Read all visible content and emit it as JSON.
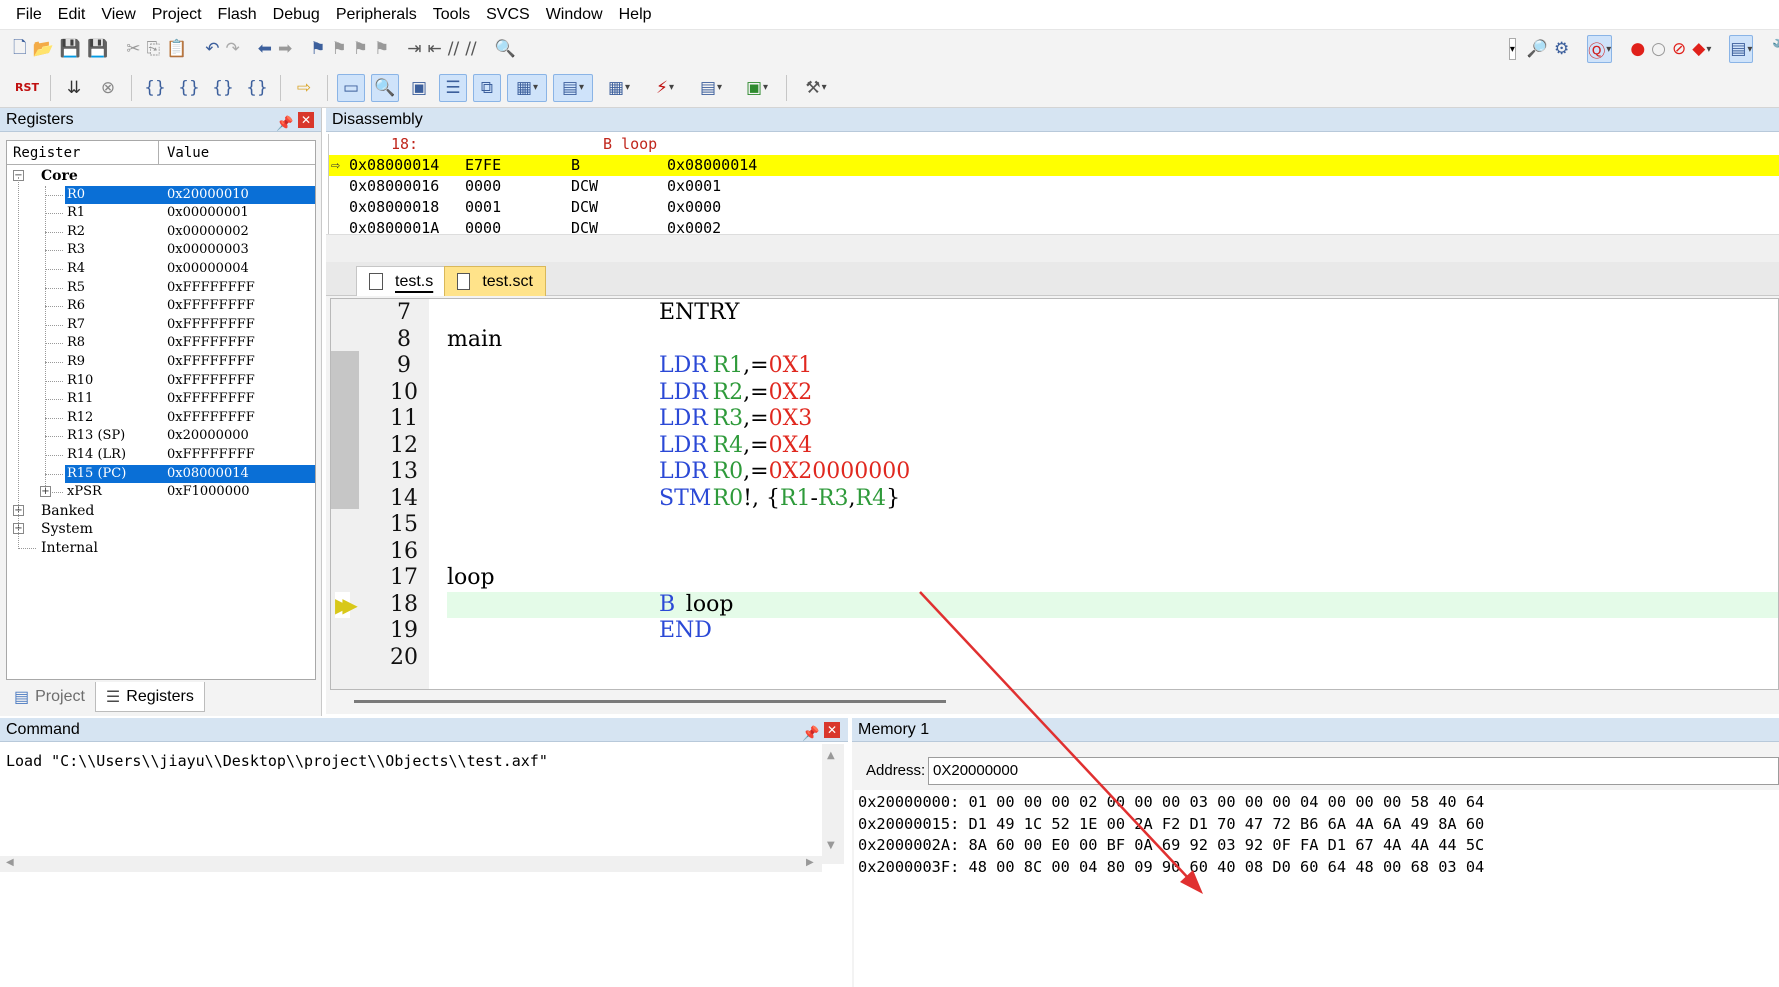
{
  "menu": [
    "File",
    "Edit",
    "View",
    "Project",
    "Flash",
    "Debug",
    "Peripherals",
    "Tools",
    "SVCS",
    "Window",
    "Help"
  ],
  "registers_panel": {
    "title": "Registers",
    "col_register": "Register",
    "col_value": "Value",
    "groups": {
      "core": "Core",
      "banked": "Banked",
      "system": "System",
      "internal": "Internal"
    },
    "rows": [
      {
        "name": "R0",
        "value": "0x20000010",
        "selected": true
      },
      {
        "name": "R1",
        "value": "0x00000001"
      },
      {
        "name": "R2",
        "value": "0x00000002"
      },
      {
        "name": "R3",
        "value": "0x00000003"
      },
      {
        "name": "R4",
        "value": "0x00000004"
      },
      {
        "name": "R5",
        "value": "0xFFFFFFFF"
      },
      {
        "name": "R6",
        "value": "0xFFFFFFFF"
      },
      {
        "name": "R7",
        "value": "0xFFFFFFFF"
      },
      {
        "name": "R8",
        "value": "0xFFFFFFFF"
      },
      {
        "name": "R9",
        "value": "0xFFFFFFFF"
      },
      {
        "name": "R10",
        "value": "0xFFFFFFFF"
      },
      {
        "name": "R11",
        "value": "0xFFFFFFFF"
      },
      {
        "name": "R12",
        "value": "0xFFFFFFFF"
      },
      {
        "name": "R13 (SP)",
        "value": "0x20000000"
      },
      {
        "name": "R14 (LR)",
        "value": "0xFFFFFFFF"
      },
      {
        "name": "R15 (PC)",
        "value": "0x08000014",
        "selected": true
      },
      {
        "name": "xPSR",
        "value": "0xF1000000"
      }
    ],
    "tabs": {
      "project": "Project",
      "registers": "Registers"
    }
  },
  "disassembly": {
    "title": "Disassembly",
    "source_line": {
      "num": "18:",
      "text": "B loop"
    },
    "lines": [
      {
        "addr": "0x08000014",
        "code": "E7FE",
        "mnem": "B",
        "op": "0x08000014",
        "current": true
      },
      {
        "addr": "0x08000016",
        "code": "0000",
        "mnem": "DCW",
        "op": "0x0001"
      },
      {
        "addr": "0x08000018",
        "code": "0001",
        "mnem": "DCW",
        "op": "0x0000"
      },
      {
        "addr": "0x0800001A",
        "code": "0000",
        "mnem": "DCW",
        "op": "0x0002"
      }
    ]
  },
  "editor": {
    "tabs": [
      "test.s",
      "test.sct"
    ],
    "lines": [
      {
        "n": "7",
        "label": "",
        "op": "ENTRY",
        "args": []
      },
      {
        "n": "8",
        "label": "main",
        "op": "",
        "args": []
      },
      {
        "n": "9",
        "label": "",
        "op": "LDR",
        "args": [
          [
            "reg",
            "R1"
          ],
          [
            "plain",
            ",="
          ],
          [
            "num",
            "0X1"
          ]
        ]
      },
      {
        "n": "10",
        "label": "",
        "op": "LDR",
        "args": [
          [
            "reg",
            "R2"
          ],
          [
            "plain",
            ",="
          ],
          [
            "num",
            "0X2"
          ]
        ]
      },
      {
        "n": "11",
        "label": "",
        "op": "LDR",
        "args": [
          [
            "reg",
            "R3"
          ],
          [
            "plain",
            ",="
          ],
          [
            "num",
            "0X3"
          ]
        ]
      },
      {
        "n": "12",
        "label": "",
        "op": "LDR",
        "args": [
          [
            "reg",
            "R4"
          ],
          [
            "plain",
            ",="
          ],
          [
            "num",
            "0X4"
          ]
        ]
      },
      {
        "n": "13",
        "label": "",
        "op": "LDR",
        "args": [
          [
            "reg",
            "R0"
          ],
          [
            "plain",
            ",="
          ],
          [
            "num",
            "0X20000000"
          ]
        ]
      },
      {
        "n": "14",
        "label": "",
        "op": "STM",
        "args": [
          [
            "reg",
            "R0"
          ],
          [
            "plain",
            "!, {"
          ],
          [
            "reg",
            "R1"
          ],
          [
            "plain",
            "-"
          ],
          [
            "reg",
            "R3"
          ],
          [
            "plain",
            ","
          ],
          [
            "reg",
            "R4"
          ],
          [
            "plain",
            "}"
          ]
        ]
      },
      {
        "n": "15",
        "label": "",
        "op": "",
        "args": []
      },
      {
        "n": "16",
        "label": "",
        "op": "",
        "args": []
      },
      {
        "n": "17",
        "label": "loop",
        "op": "",
        "args": []
      },
      {
        "n": "18",
        "label": "",
        "op": "B",
        "args": [
          [
            "plainop",
            "loop"
          ]
        ],
        "current": true
      },
      {
        "n": "19",
        "label": "",
        "op": "END",
        "args": []
      },
      {
        "n": "20",
        "label": "",
        "op": "",
        "args": []
      }
    ]
  },
  "command": {
    "title": "Command",
    "text": "Load \"C:\\\\Users\\\\jiayu\\\\Desktop\\\\project\\\\Objects\\\\test.axf\""
  },
  "memory": {
    "title": "Memory 1",
    "address_label": "Address:",
    "address_value": "0X20000000",
    "lines": [
      "0x20000000: 01 00 00 00 02 00 00 00 03 00 00 00 04 00 00 00 58 40 64",
      "0x20000015: D1 49 1C 52 1E 00 2A F2 D1 70 47 72 B6 6A 4A 6A 49 8A 60",
      "0x2000002A: 8A 60 00 E0 00 BF 0A 69 92 03 92 0F FA D1 67 4A 4A 44 5C",
      "0x2000003F: 48 00 8C 00 04 80 09 90 60 40 08 D0 60 64 48 00 68 03 04"
    ]
  },
  "colors": {
    "selection": "#0a6fd6",
    "current_line": "#ffff00",
    "keyword": "#2b49d6",
    "register": "#2e9a3a",
    "number": "#e0281f",
    "arrow": "#e03030"
  }
}
